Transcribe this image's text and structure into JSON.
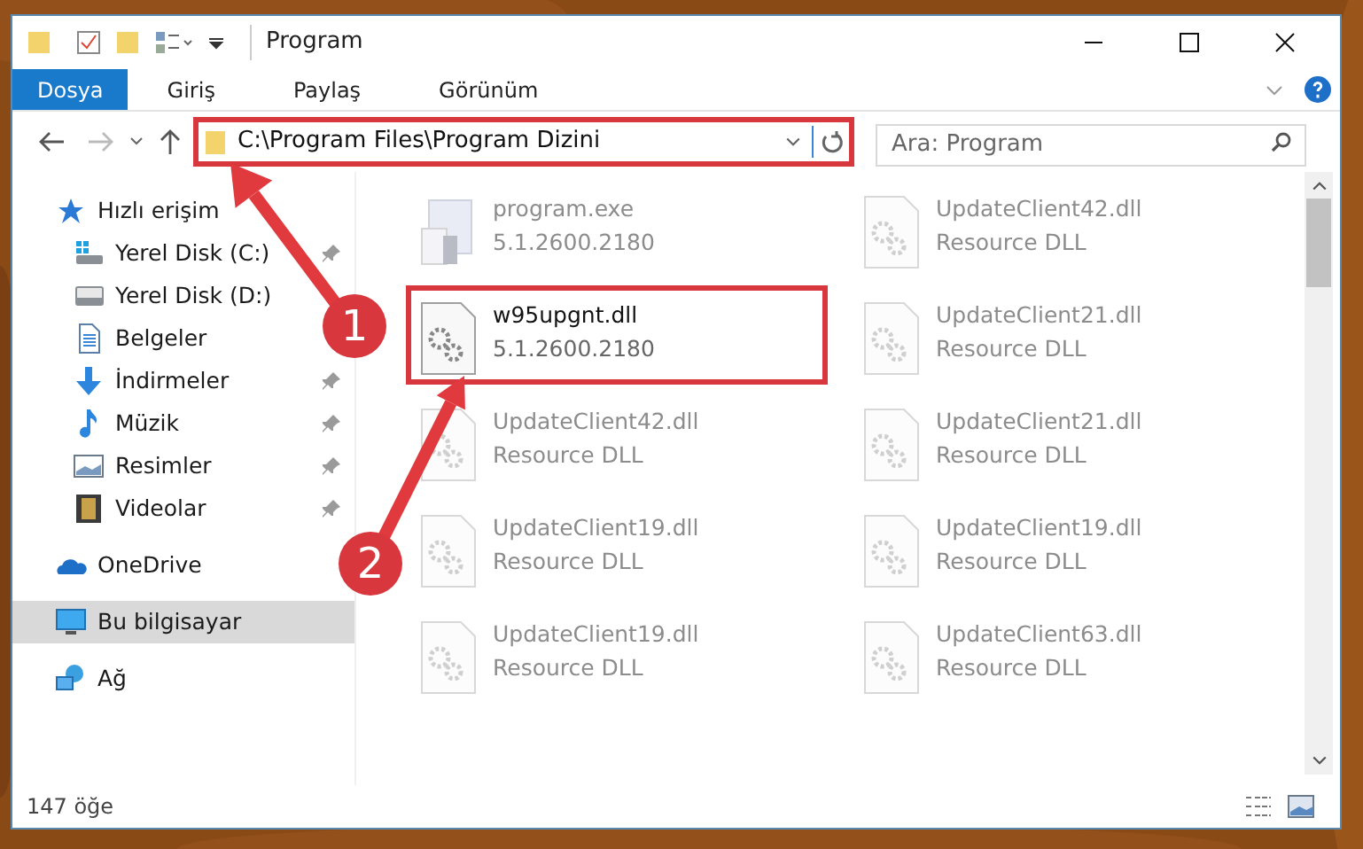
{
  "window": {
    "title": "Program"
  },
  "ribbon_tabs": [
    {
      "label": "Dosya",
      "kind": "file"
    },
    {
      "label": "Giriş",
      "kind": "tab"
    },
    {
      "label": "Paylaş",
      "kind": "tab"
    },
    {
      "label": "Görünüm",
      "kind": "tab"
    }
  ],
  "address": {
    "value": "C:\\Program Files\\Program Dizini",
    "highlighted": true
  },
  "search": {
    "placeholder": "Ara: Program"
  },
  "sidebar": {
    "items": [
      {
        "label": "Hızlı erişim",
        "selected": false,
        "children": [
          {
            "label": "Yerel Disk (C:)",
            "pinned": true,
            "selected": false
          },
          {
            "label": "Yerel Disk (D:)",
            "selected": false
          },
          {
            "label": "Belgeler",
            "selected": false
          },
          {
            "label": "İndirmeler",
            "pinned": true,
            "selected": false
          },
          {
            "label": "Müzik",
            "pinned": true,
            "selected": false
          },
          {
            "label": "Resimler",
            "pinned": true,
            "selected": false
          },
          {
            "label": "Videolar",
            "pinned": true,
            "selected": false
          }
        ]
      },
      {
        "label": "OneDrive",
        "selected": false
      },
      {
        "label": "Bu bilgisayar",
        "selected": true
      },
      {
        "label": "Ağ",
        "selected": false
      }
    ]
  },
  "files": [
    {
      "name": "program.exe",
      "detail": "5.1.2600.2180",
      "kind": "exe",
      "faded": true,
      "highlighted": false
    },
    {
      "name": "UpdateClient42.dll",
      "detail": "Resource DLL",
      "kind": "dll",
      "faded": true,
      "highlighted": false
    },
    {
      "name": "w95upgnt.dll",
      "detail": "5.1.2600.2180",
      "kind": "dll",
      "faded": false,
      "highlighted": true
    },
    {
      "name": "UpdateClient21.dll",
      "detail": "Resource DLL",
      "kind": "dll",
      "faded": true,
      "highlighted": false
    },
    {
      "name": "UpdateClient42.dll",
      "detail": "Resource DLL",
      "kind": "dll",
      "faded": true,
      "highlighted": false
    },
    {
      "name": "UpdateClient21.dll",
      "detail": "Resource DLL",
      "kind": "dll",
      "faded": true,
      "highlighted": false
    },
    {
      "name": "UpdateClient19.dll",
      "detail": "Resource DLL",
      "kind": "dll",
      "faded": true,
      "highlighted": false
    },
    {
      "name": "UpdateClient19.dll",
      "detail": "Resource DLL",
      "kind": "dll",
      "faded": true,
      "highlighted": false
    },
    {
      "name": "UpdateClient19.dll",
      "detail": "Resource DLL",
      "kind": "dll",
      "faded": true,
      "highlighted": false
    },
    {
      "name": "UpdateClient63.dll",
      "detail": "Resource DLL",
      "kind": "dll",
      "faded": true,
      "highlighted": false
    }
  ],
  "status_bar": {
    "count": "147 öğe"
  },
  "annotations": [
    {
      "label": "1"
    },
    {
      "label": "2"
    }
  ]
}
